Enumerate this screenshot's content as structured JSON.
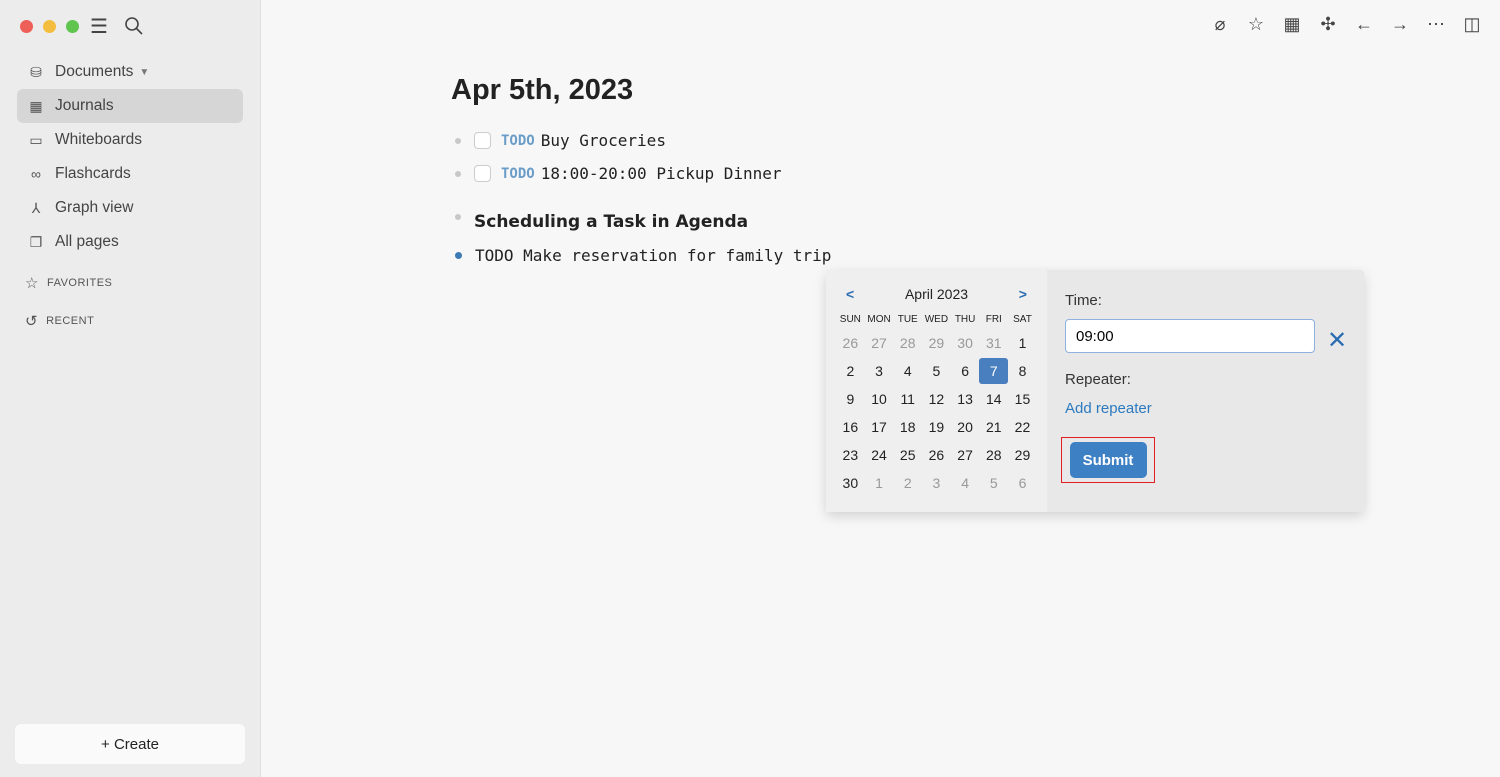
{
  "sidebar": {
    "items": [
      {
        "label": "Documents",
        "icon": "database-icon"
      },
      {
        "label": "Journals",
        "icon": "calendar-icon"
      },
      {
        "label": "Whiteboards",
        "icon": "whiteboard-icon"
      },
      {
        "label": "Flashcards",
        "icon": "infinity-icon"
      },
      {
        "label": "Graph view",
        "icon": "graph-icon"
      },
      {
        "label": "All pages",
        "icon": "pages-icon"
      }
    ],
    "favorites": "FAVORITES",
    "recent": "RECENT",
    "create": "+ Create"
  },
  "page": {
    "title": "Apr 5th, 2023",
    "blocks": [
      {
        "marker": "TODO",
        "text": "Buy Groceries"
      },
      {
        "marker": "TODO",
        "text": "18:00-20:00 Pickup Dinner"
      }
    ],
    "heading": "Scheduling a Task in Agenda",
    "editing": "TODO Make reservation for family trip"
  },
  "calendar": {
    "month": "April 2023",
    "prev": "<",
    "next": ">",
    "days": [
      "SUN",
      "MON",
      "TUE",
      "WED",
      "THU",
      "FRI",
      "SAT"
    ],
    "cells": [
      "26",
      "27",
      "28",
      "29",
      "30",
      "31",
      "1",
      "2",
      "3",
      "4",
      "5",
      "6",
      "7",
      "8",
      "9",
      "10",
      "11",
      "12",
      "13",
      "14",
      "15",
      "16",
      "17",
      "18",
      "19",
      "20",
      "21",
      "22",
      "23",
      "24",
      "25",
      "26",
      "27",
      "28",
      "29",
      "30",
      "1",
      "2",
      "3",
      "4",
      "5",
      "6"
    ],
    "selected": "7"
  },
  "time": {
    "label": "Time:",
    "value": "09:00",
    "repeater_label": "Repeater:",
    "add_repeater": "Add repeater",
    "submit": "Submit",
    "close": "✕"
  },
  "colors": {
    "accent": "#3d80c4",
    "highlight": "#e02020"
  }
}
